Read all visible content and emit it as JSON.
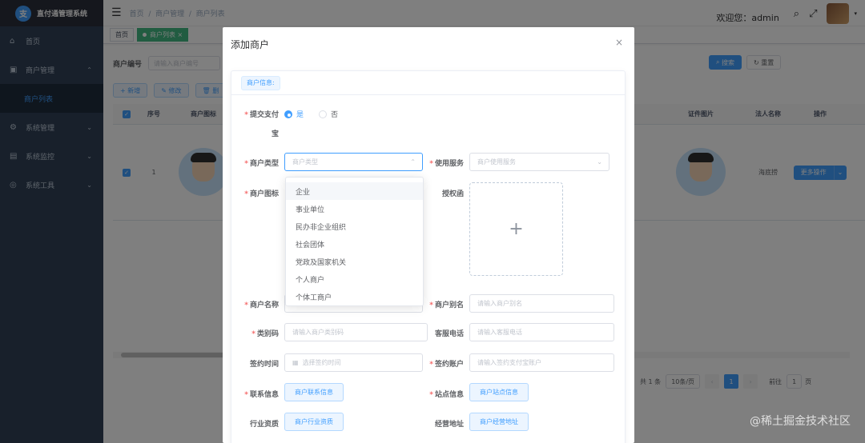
{
  "app": {
    "title": "直付通管理系统",
    "logo_glyph": "支"
  },
  "sidebar": {
    "items": [
      {
        "label": "首页",
        "icon": "dashboard-icon",
        "glyph": "⌂"
      },
      {
        "label": "商户管理",
        "icon": "shop-icon",
        "glyph": "▣",
        "arrow": "⌃"
      },
      {
        "label": "商户列表",
        "icon": "list-icon",
        "sub": true
      },
      {
        "label": "系统管理",
        "icon": "gear-icon",
        "glyph": "⚙",
        "arrow": "⌄"
      },
      {
        "label": "系统监控",
        "icon": "monitor-icon",
        "glyph": "▤",
        "arrow": "⌄"
      },
      {
        "label": "系统工具",
        "icon": "tool-icon",
        "glyph": "◎",
        "arrow": "⌄"
      }
    ]
  },
  "navbar": {
    "breadcrumb": [
      "首页",
      "商户管理",
      "商户列表"
    ],
    "separator": "/",
    "welcome": "欢迎您：admin",
    "icons": [
      "search-icon",
      "fullscreen-icon",
      "avatar"
    ]
  },
  "tags": [
    {
      "label": "首页"
    },
    {
      "label": "商户列表",
      "active": true
    }
  ],
  "search": {
    "label": "商户编号",
    "placeholder": "请输入商户编号",
    "search_btn": "搜索",
    "reset_btn": "重置"
  },
  "toolbar": {
    "add": "新增",
    "edit": "修改",
    "delete": "删"
  },
  "table": {
    "headers": [
      "序号",
      "商户图标",
      "证件图片",
      "法人名称",
      "操作"
    ],
    "rows": [
      {
        "index": "1",
        "legal_name": "海底捞",
        "action": "更多操作"
      }
    ]
  },
  "pager": {
    "total": "共 1 条",
    "page_size": "10条/页",
    "current": "1",
    "goto_label": "前往",
    "goto_value": "1",
    "goto_suffix": "页"
  },
  "dialog": {
    "title": "添加商户",
    "close": "×",
    "section": "商户信息:",
    "fields": {
      "alipay_label_1": "提交支付",
      "alipay_label_2": "宝",
      "alipay_yes": "是",
      "alipay_no": "否",
      "type_label": "商户类型",
      "type_placeholder": "商户类型",
      "service_label": "使用服务",
      "service_placeholder": "商户使用服务",
      "icon_label": "商户图标",
      "auth_label": "授权函",
      "name_label": "商户名称",
      "alias_label": "商户别名",
      "alias_placeholder": "请输入商户别名",
      "category_label": "类别码",
      "category_placeholder": "请输入商户类别码",
      "phone_label": "客服电话",
      "phone_placeholder": "请输入客服电话",
      "sign_time_label": "签约时间",
      "sign_time_placeholder": "选择签约时间",
      "sign_account_label": "签约账户",
      "sign_account_placeholder": "请输入签约支付宝账户",
      "contact_label": "联系信息",
      "contact_btn": "商户联系信息",
      "site_label": "站点信息",
      "site_btn": "商户站点信息",
      "industry_label": "行业资质",
      "industry_btn": "商户行业资质",
      "address_label": "经营地址",
      "address_btn": "商户经营地址",
      "upload_plus": "+"
    },
    "type_options": [
      "企业",
      "事业单位",
      "民办非企业组织",
      "社会团体",
      "党政及国家机关",
      "个人商户",
      "个体工商户"
    ]
  },
  "watermark": "@稀土掘金技术社区",
  "colors": {
    "primary": "#409eff",
    "sidebar": "#304156",
    "danger": "#f56c6c"
  }
}
